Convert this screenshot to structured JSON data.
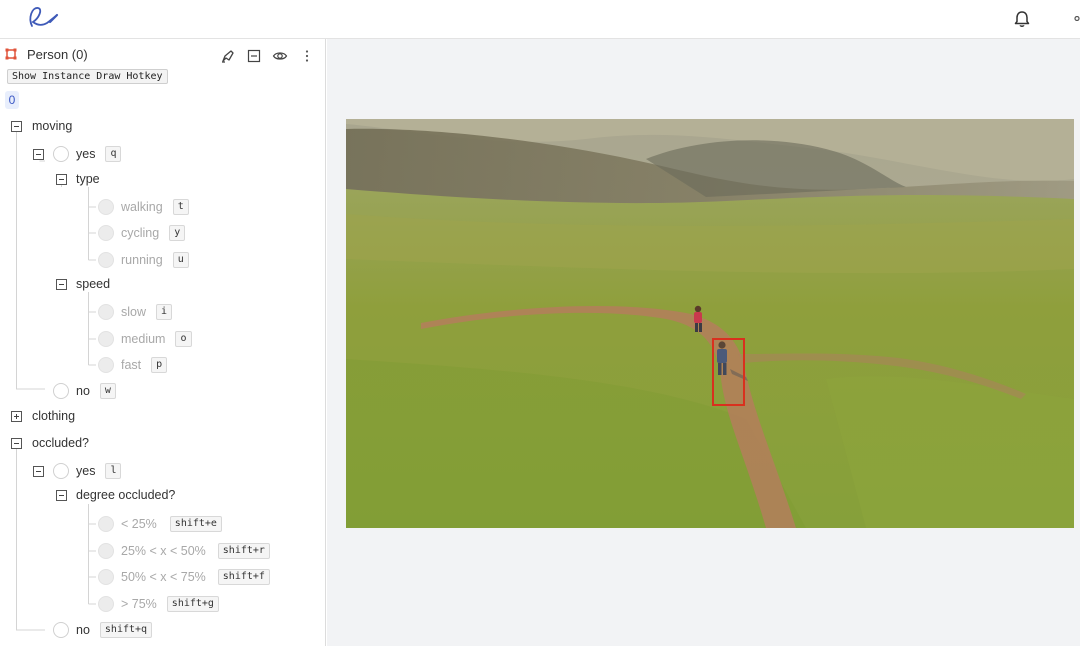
{
  "header": {
    "logo_icon": "signature-logo-icon",
    "notifications_icon": "bell-icon"
  },
  "panel": {
    "class_name": "Person (0)",
    "class_color": "#e0533a",
    "tools": [
      "brush-icon",
      "collapse-icon",
      "eye-icon",
      "more-vertical-icon"
    ],
    "hotkey_button": "Show Instance Draw Hotkey",
    "instance_id": "0"
  },
  "tree": {
    "moving": "moving",
    "moving_yes": "yes",
    "moving_yes_key": "q",
    "type": "type",
    "walking": "walking",
    "walking_key": "t",
    "cycling": "cycling",
    "cycling_key": "y",
    "running": "running",
    "running_key": "u",
    "speed": "speed",
    "slow": "slow",
    "slow_key": "i",
    "medium": "medium",
    "medium_key": "o",
    "fast": "fast",
    "fast_key": "p",
    "moving_no": "no",
    "moving_no_key": "w",
    "clothing": "clothing",
    "occluded": "occluded?",
    "occ_yes": "yes",
    "occ_yes_key": "l",
    "degree": "degree occluded?",
    "deg1": "< 25%",
    "deg1_key": "shift+e",
    "deg2": "25% < x < 50%",
    "deg2_key": "shift+r",
    "deg3": "50% < x < 75%",
    "deg3_key": "shift+f",
    "deg4": "> 75%",
    "deg4_key": "shift+g",
    "occ_no": "no",
    "occ_no_key": "shift+q"
  },
  "workspace": {
    "bbox_color": "#d9301e",
    "background": "#f2f3f5"
  }
}
